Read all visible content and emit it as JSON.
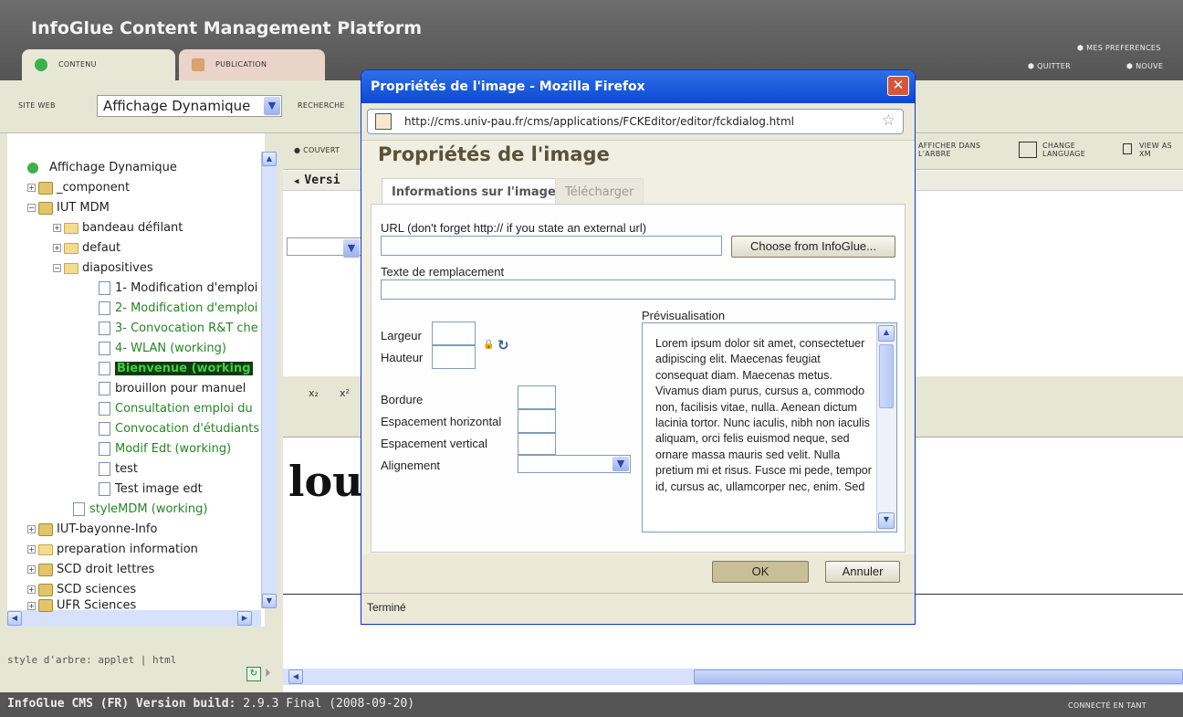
{
  "app": {
    "title": "InfoGlue Content Management Platform"
  },
  "tabs": {
    "content": "CONTENU",
    "publication": "PUBLICATION"
  },
  "header_links": {
    "preferences": "MES PREFERENCES",
    "quit": "QUITTER",
    "new": "NOUVE"
  },
  "site": {
    "label": "SITE WEB",
    "selected": "Affichage Dynamique",
    "search_label": "RECHERCHE"
  },
  "tree": {
    "items": [
      {
        "label": "Affichage Dynamique"
      },
      {
        "label": "_component"
      },
      {
        "label": "IUT MDM"
      },
      {
        "label": "bandeau défilant"
      },
      {
        "label": "defaut"
      },
      {
        "label": "diapositives"
      },
      {
        "label": "1- Modification d'emploi"
      },
      {
        "label": "2- Modification d'emploi"
      },
      {
        "label": "3- Convocation R&T che"
      },
      {
        "label": "4- WLAN (working)"
      },
      {
        "label": "Bienvenue (working"
      },
      {
        "label": "brouillon pour manuel"
      },
      {
        "label": "Consultation emploi du"
      },
      {
        "label": "Convocation d'étudiants"
      },
      {
        "label": "Modif Edt (working)"
      },
      {
        "label": "test"
      },
      {
        "label": "Test image edt"
      },
      {
        "label": "styleMDM (working)"
      },
      {
        "label": "IUT-bayonne-Info"
      },
      {
        "label": "preparation information"
      },
      {
        "label": "SCD droit lettres"
      },
      {
        "label": "SCD sciences"
      },
      {
        "label": "UFR Sciences"
      }
    ],
    "style_label": "style d'arbre: applet | html"
  },
  "right_toolbar": {
    "cover": "COUVERT",
    "version": "Versi",
    "show_tree": "AFFICHER DANS L'ARBRE",
    "change_language": "CHANGE LANGUAGE",
    "view_xml": "VIEW AS XM",
    "big_text": "lou"
  },
  "status": {
    "version_prefix": "InfoGlue CMS (FR) Version build:",
    "version_value": "2.9.3 Final (2008-09-20)",
    "connected": "CONNECTÉ EN TANT"
  },
  "dialog": {
    "window_title": "Propriétés de l'image - Mozilla Firefox",
    "url": "http://cms.univ-pau.fr/cms/applications/FCKEditor/editor/fckdialog.html",
    "heading": "Propriétés de l'image",
    "tab_info": "Informations sur l'image",
    "tab_upload": "Télécharger",
    "url_label": "URL (don't forget http:// if you state an external url)",
    "choose_btn": "Choose from InfoGlue...",
    "alt_label": "Texte de remplacement",
    "width_label": "Largeur",
    "height_label": "Hauteur",
    "border_label": "Bordure",
    "hspace_label": "Espacement horizontal",
    "vspace_label": "Espacement vertical",
    "align_label": "Alignement",
    "preview_label": "Prévisualisation",
    "preview_text": "Lorem ipsum dolor sit amet, consectetuer adipiscing elit. Maecenas feugiat consequat diam. Maecenas metus. Vivamus diam purus, cursus a, commodo non, facilisis vitae, nulla. Aenean dictum lacinia tortor. Nunc iaculis, nibh non iaculis aliquam, orci felis euismod neque, sed ornare massa mauris sed velit. Nulla pretium mi et risus. Fusce mi pede, tempor id, cursus ac, ullamcorper nec, enim. Sed",
    "ok": "OK",
    "cancel": "Annuler",
    "status": "Terminé"
  }
}
